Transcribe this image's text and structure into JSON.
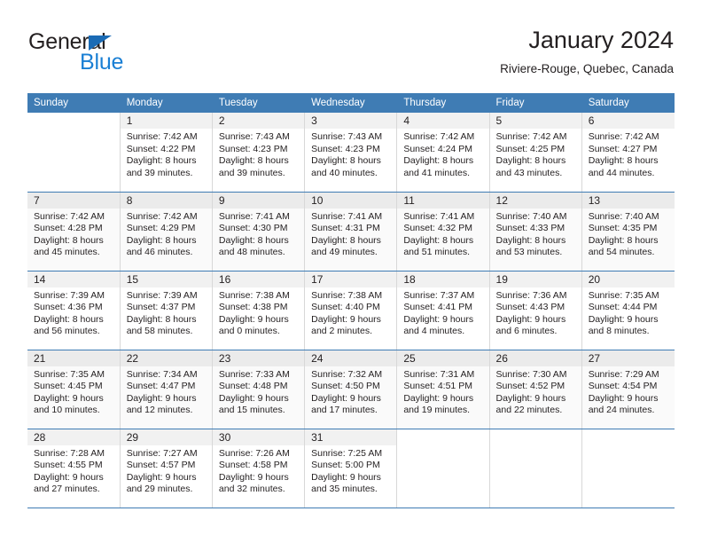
{
  "brand": {
    "name_part1": "General",
    "name_part2": "Blue",
    "triangle_icon": "blue-triangle-logo-mark"
  },
  "header": {
    "title": "January 2024",
    "subtitle": "Riviere-Rouge, Quebec, Canada"
  },
  "colors": {
    "header_blue": "#3f7cb4",
    "brand_blue": "#1a7fd4",
    "daynum_band": "#f1f1f1",
    "text": "#231f20"
  },
  "calendar": {
    "weekdays": [
      "Sunday",
      "Monday",
      "Tuesday",
      "Wednesday",
      "Thursday",
      "Friday",
      "Saturday"
    ],
    "weeks": [
      [
        {
          "day": "",
          "lines": []
        },
        {
          "day": "1",
          "lines": [
            "Sunrise: 7:42 AM",
            "Sunset: 4:22 PM",
            "Daylight: 8 hours",
            "and 39 minutes."
          ]
        },
        {
          "day": "2",
          "lines": [
            "Sunrise: 7:43 AM",
            "Sunset: 4:23 PM",
            "Daylight: 8 hours",
            "and 39 minutes."
          ]
        },
        {
          "day": "3",
          "lines": [
            "Sunrise: 7:43 AM",
            "Sunset: 4:23 PM",
            "Daylight: 8 hours",
            "and 40 minutes."
          ]
        },
        {
          "day": "4",
          "lines": [
            "Sunrise: 7:42 AM",
            "Sunset: 4:24 PM",
            "Daylight: 8 hours",
            "and 41 minutes."
          ]
        },
        {
          "day": "5",
          "lines": [
            "Sunrise: 7:42 AM",
            "Sunset: 4:25 PM",
            "Daylight: 8 hours",
            "and 43 minutes."
          ]
        },
        {
          "day": "6",
          "lines": [
            "Sunrise: 7:42 AM",
            "Sunset: 4:27 PM",
            "Daylight: 8 hours",
            "and 44 minutes."
          ]
        }
      ],
      [
        {
          "day": "7",
          "lines": [
            "Sunrise: 7:42 AM",
            "Sunset: 4:28 PM",
            "Daylight: 8 hours",
            "and 45 minutes."
          ]
        },
        {
          "day": "8",
          "lines": [
            "Sunrise: 7:42 AM",
            "Sunset: 4:29 PM",
            "Daylight: 8 hours",
            "and 46 minutes."
          ]
        },
        {
          "day": "9",
          "lines": [
            "Sunrise: 7:41 AM",
            "Sunset: 4:30 PM",
            "Daylight: 8 hours",
            "and 48 minutes."
          ]
        },
        {
          "day": "10",
          "lines": [
            "Sunrise: 7:41 AM",
            "Sunset: 4:31 PM",
            "Daylight: 8 hours",
            "and 49 minutes."
          ]
        },
        {
          "day": "11",
          "lines": [
            "Sunrise: 7:41 AM",
            "Sunset: 4:32 PM",
            "Daylight: 8 hours",
            "and 51 minutes."
          ]
        },
        {
          "day": "12",
          "lines": [
            "Sunrise: 7:40 AM",
            "Sunset: 4:33 PM",
            "Daylight: 8 hours",
            "and 53 minutes."
          ]
        },
        {
          "day": "13",
          "lines": [
            "Sunrise: 7:40 AM",
            "Sunset: 4:35 PM",
            "Daylight: 8 hours",
            "and 54 minutes."
          ]
        }
      ],
      [
        {
          "day": "14",
          "lines": [
            "Sunrise: 7:39 AM",
            "Sunset: 4:36 PM",
            "Daylight: 8 hours",
            "and 56 minutes."
          ]
        },
        {
          "day": "15",
          "lines": [
            "Sunrise: 7:39 AM",
            "Sunset: 4:37 PM",
            "Daylight: 8 hours",
            "and 58 minutes."
          ]
        },
        {
          "day": "16",
          "lines": [
            "Sunrise: 7:38 AM",
            "Sunset: 4:38 PM",
            "Daylight: 9 hours",
            "and 0 minutes."
          ]
        },
        {
          "day": "17",
          "lines": [
            "Sunrise: 7:38 AM",
            "Sunset: 4:40 PM",
            "Daylight: 9 hours",
            "and 2 minutes."
          ]
        },
        {
          "day": "18",
          "lines": [
            "Sunrise: 7:37 AM",
            "Sunset: 4:41 PM",
            "Daylight: 9 hours",
            "and 4 minutes."
          ]
        },
        {
          "day": "19",
          "lines": [
            "Sunrise: 7:36 AM",
            "Sunset: 4:43 PM",
            "Daylight: 9 hours",
            "and 6 minutes."
          ]
        },
        {
          "day": "20",
          "lines": [
            "Sunrise: 7:35 AM",
            "Sunset: 4:44 PM",
            "Daylight: 9 hours",
            "and 8 minutes."
          ]
        }
      ],
      [
        {
          "day": "21",
          "lines": [
            "Sunrise: 7:35 AM",
            "Sunset: 4:45 PM",
            "Daylight: 9 hours",
            "and 10 minutes."
          ]
        },
        {
          "day": "22",
          "lines": [
            "Sunrise: 7:34 AM",
            "Sunset: 4:47 PM",
            "Daylight: 9 hours",
            "and 12 minutes."
          ]
        },
        {
          "day": "23",
          "lines": [
            "Sunrise: 7:33 AM",
            "Sunset: 4:48 PM",
            "Daylight: 9 hours",
            "and 15 minutes."
          ]
        },
        {
          "day": "24",
          "lines": [
            "Sunrise: 7:32 AM",
            "Sunset: 4:50 PM",
            "Daylight: 9 hours",
            "and 17 minutes."
          ]
        },
        {
          "day": "25",
          "lines": [
            "Sunrise: 7:31 AM",
            "Sunset: 4:51 PM",
            "Daylight: 9 hours",
            "and 19 minutes."
          ]
        },
        {
          "day": "26",
          "lines": [
            "Sunrise: 7:30 AM",
            "Sunset: 4:52 PM",
            "Daylight: 9 hours",
            "and 22 minutes."
          ]
        },
        {
          "day": "27",
          "lines": [
            "Sunrise: 7:29 AM",
            "Sunset: 4:54 PM",
            "Daylight: 9 hours",
            "and 24 minutes."
          ]
        }
      ],
      [
        {
          "day": "28",
          "lines": [
            "Sunrise: 7:28 AM",
            "Sunset: 4:55 PM",
            "Daylight: 9 hours",
            "and 27 minutes."
          ]
        },
        {
          "day": "29",
          "lines": [
            "Sunrise: 7:27 AM",
            "Sunset: 4:57 PM",
            "Daylight: 9 hours",
            "and 29 minutes."
          ]
        },
        {
          "day": "30",
          "lines": [
            "Sunrise: 7:26 AM",
            "Sunset: 4:58 PM",
            "Daylight: 9 hours",
            "and 32 minutes."
          ]
        },
        {
          "day": "31",
          "lines": [
            "Sunrise: 7:25 AM",
            "Sunset: 5:00 PM",
            "Daylight: 9 hours",
            "and 35 minutes."
          ]
        },
        {
          "day": "",
          "lines": []
        },
        {
          "day": "",
          "lines": []
        },
        {
          "day": "",
          "lines": []
        }
      ]
    ]
  }
}
